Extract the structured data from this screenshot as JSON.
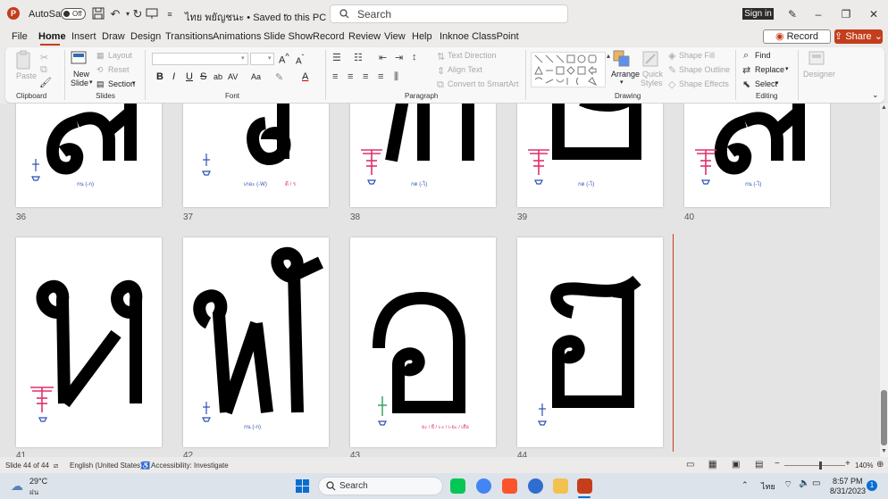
{
  "titlebar": {
    "autosave_label": "AutoSave",
    "autosave_state": "Off",
    "doc_name": "ไทย พยัญชนะ • Saved to this PC",
    "search_placeholder": "Search",
    "signin_label": "Sign in"
  },
  "menu": {
    "tabs": [
      "File",
      "Home",
      "Insert",
      "Draw",
      "Design",
      "Transitions",
      "Animations",
      "Slide Show",
      "Record",
      "Review",
      "View",
      "Help",
      "Inknoe ClassPoint"
    ],
    "active_tab": "Home",
    "record_label": "Record",
    "share_label": "Share"
  },
  "ribbon": {
    "groups": {
      "clipboard": "Clipboard",
      "slides": "Slides",
      "font": "Font",
      "paragraph": "Paragraph",
      "drawing": "Drawing",
      "editing": "Editing"
    },
    "paste_label": "Paste",
    "new_slide_label": "New",
    "new_slide_label2": "Slide",
    "layout_label": "Layout",
    "reset_label": "Reset",
    "section_label": "Section",
    "font_buttons": [
      "B",
      "I",
      "U",
      "S",
      "ab",
      "AV",
      "Aa",
      "A",
      "A"
    ],
    "text_direction_label": "Text Direction",
    "align_text_label": "Align Text",
    "convert_smartart_label": "Convert to SmartArt",
    "arrange_label": "Arrange",
    "quick_styles_label": "Quick",
    "quick_styles_label2": "Styles",
    "shape_fill_label": "Shape Fill",
    "shape_outline_label": "Shape Outline",
    "shape_effects_label": "Shape Effects",
    "find_label": "Find",
    "replace_label": "Replace",
    "select_label": "Select",
    "designer_label": "Designer"
  },
  "slides": {
    "top_row": [
      {
        "number": "36",
        "glyph": "ง",
        "caption": "กน (-ก)"
      },
      {
        "number": "37",
        "glyph": "ด",
        "caption": "เกอะ (-W)",
        "caption2": "ดี / ร"
      },
      {
        "number": "38",
        "glyph": "ท",
        "caption": "กด (-ไ)"
      },
      {
        "number": "39",
        "glyph": "บ",
        "caption": "กด (-ไ)"
      },
      {
        "number": "40",
        "glyph": "ง",
        "caption": "กน (-ไ)"
      }
    ],
    "bottom_row": [
      {
        "number": "41",
        "glyph": "ห",
        "caption": ""
      },
      {
        "number": "42",
        "glyph": "ฬ",
        "caption": "กน (-ก)"
      },
      {
        "number": "43",
        "glyph": "อ",
        "caption": "ยะ / ยื / เ-ะ / เ-ยะ / เสือ"
      },
      {
        "number": "44",
        "glyph": "ฮ",
        "caption": ""
      }
    ]
  },
  "statusbar": {
    "slide_info": "Slide 44 of 44",
    "language": "English (United States)",
    "accessibility": "Accessibility: Investigate",
    "zoom": "140%"
  },
  "taskbar": {
    "weather_temp": "29°C",
    "weather_desc": "ฝน",
    "search_label": "Search",
    "lang": "ไทย",
    "time": "8:57 PM",
    "date": "8/31/2023",
    "notification_count": "1"
  },
  "colors": {
    "accent": "#c43e1c",
    "marker_pink": "#e0306a",
    "marker_blue": "#2b4fb5",
    "marker_green": "#2e9e5b"
  }
}
